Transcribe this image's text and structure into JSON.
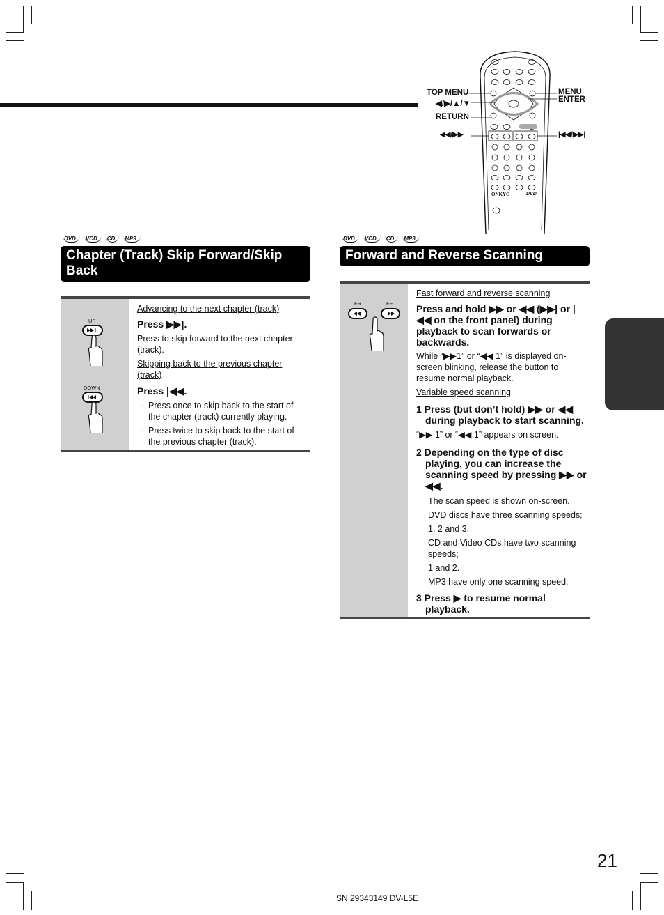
{
  "remote": {
    "callouts": {
      "top_menu": "TOP MENU",
      "arrows": "◀/▶/▲/▼",
      "return": "RETURN",
      "scan": "◀◀/▶▶",
      "menu": "MENU",
      "enter": "ENTER",
      "skip": "|◀◀/▶▶|"
    },
    "brand": "ONKYO",
    "logo": "DVD"
  },
  "left_section": {
    "disc_types": [
      "DVD",
      "VCD",
      "CD",
      "MP3"
    ],
    "title": "Chapter (Track) Skip Forward/Skip Back",
    "buttons": [
      {
        "label": "UP",
        "icon": "skip-next-icon",
        "glyph": "▶▶|"
      },
      {
        "label": "DOWN",
        "icon": "skip-prev-icon",
        "glyph": "|◀◀"
      }
    ],
    "sub1": "Advancing to the next chapter (track)",
    "step1_heading": "Press ▶▶|.",
    "step1_text": "Press to skip forward to the next chapter (track).",
    "sub2": "Skipping back to the previous chapter (track)",
    "step2_heading": "Press |◀◀.",
    "bullets": [
      "Press once to skip back to the start of the chapter (track) currently playing.",
      "Press twice to skip back to the start of the previous chapter (track)."
    ]
  },
  "right_section": {
    "disc_types": [
      "DVD",
      "VCD",
      "CD",
      "MP3"
    ],
    "title": "Forward and Reverse Scanning",
    "buttons": [
      {
        "label": "FR",
        "icon": "rewind-icon",
        "glyph": "◀◀"
      },
      {
        "label": "FF",
        "icon": "fast-forward-icon",
        "glyph": "▶▶"
      }
    ],
    "sub1": "Fast forward and reverse scanning",
    "heading1": "Press and hold ▶▶ or ◀◀ (▶▶| or |◀◀ on the front panel) during playback to scan forwards or backwards.",
    "text1": "While “▶▶1” or “◀◀ 1” is displayed on-screen blinking, release the button to resume normal playback.",
    "sub2": "Variable speed scanning",
    "step1": "1 Press (but don’t hold) ▶▶ or ◀◀ during playback to start scanning.",
    "step1_note": "“▶▶ 1” or “◀◀ 1” appears on screen.",
    "step2": "2 Depending on the type of disc playing, you can increase the scanning speed by pressing ▶▶ or ◀◀.",
    "step2_notes": [
      "The scan speed is shown on-screen.",
      "DVD discs have three scanning speeds;",
      "1, 2 and 3.",
      "CD and Video CDs have two scanning speeds;",
      "1 and 2.",
      "MP3 have only one scanning speed."
    ],
    "step3": "3 Press ▶ to resume normal playback."
  },
  "page_number": "21",
  "footer": "SN 29343149 DV-L5E"
}
